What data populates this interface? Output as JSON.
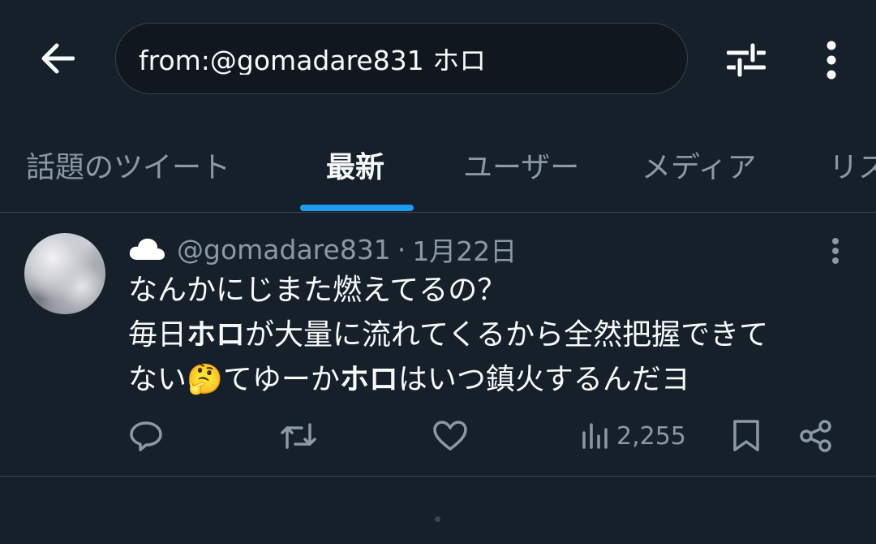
{
  "search": {
    "query": "from:@gomadare831 ホロ"
  },
  "tabs": [
    {
      "label": "話題のツイート"
    },
    {
      "label": "最新"
    },
    {
      "label": "ユーザー"
    },
    {
      "label": "メディア"
    },
    {
      "label": "リスト"
    }
  ],
  "active_tab": "最新",
  "colors": {
    "background": "#15202b",
    "accent": "#1d9bf0",
    "secondary_text": "#8b98a5",
    "divider": "#38444d"
  },
  "icons": {
    "back": "arrow-left-icon",
    "filter": "sliders-icon",
    "more": "vertical-ellipsis-icon",
    "reply": "speech-bubble-icon",
    "retweet": "retweet-arrows-icon",
    "like": "heart-icon",
    "views": "bar-chart-icon",
    "bookmark": "bookmark-icon",
    "share": "share-nodes-icon"
  },
  "tweet": {
    "display_name_emoji": "☁️",
    "handle": "@gomadare831",
    "separator": "·",
    "date": "1月22日",
    "lines": [
      {
        "text": "なんかにじまた燃えてるの？"
      },
      {
        "pre": "毎日",
        "bold": "ホロ",
        "post": "が大量に流れてくるから全然把握できて"
      },
      {
        "pre": "ない",
        "emoji": "🤔",
        "mid": "てゆーか",
        "bold": "ホロ",
        "post": "はいつ鎮火するんだヨ"
      }
    ],
    "views": "2,255"
  }
}
